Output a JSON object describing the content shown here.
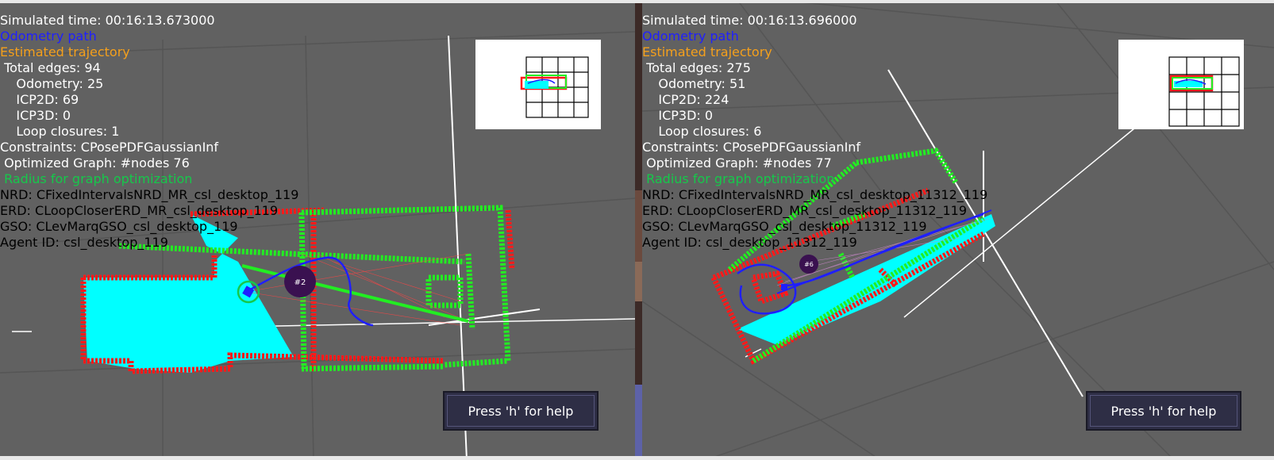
{
  "left": {
    "sim_time": "Simulated time: 00:16:13.673000",
    "odometry_path": "Odometry path",
    "estimated_trajectory": "Estimated trajectory",
    "total_edges": " Total edges: 94",
    "odometry": "    Odometry: 25",
    "icp2d": "    ICP2D: 69",
    "icp3d": "    ICP3D: 0",
    "loop_closures": "    Loop closures: 1",
    "constraints": "Constraints: CPosePDFGaussianInf",
    "optimized_graph": " Optimized Graph: #nodes 76",
    "radius": " Radius for graph optimization",
    "nrd": "NRD: CFixedIntervalsNRD_MR_csl_desktop_119",
    "erd": "ERD: CLoopCloserERD_MR_csl_desktop_119",
    "gso": "GSO: CLevMarqGSO_csl_desktop_119",
    "agent": "Agent ID: csl_desktop_119",
    "node_label": "#2",
    "help": "Press 'h' for help"
  },
  "right": {
    "sim_time": "Simulated time: 00:16:13.696000",
    "odometry_path": "Odometry path",
    "estimated_trajectory": "Estimated trajectory",
    "total_edges": " Total edges: 275",
    "odometry": "    Odometry: 51",
    "icp2d": "    ICP2D: 224",
    "icp3d": "    ICP3D: 0",
    "loop_closures": "    Loop closures: 6",
    "constraints": "Constraints: CPosePDFGaussianInf",
    "optimized_graph": " Optimized Graph: #nodes 77",
    "radius": " Radius for graph optimization",
    "nrd": "NRD: CFixedIntervalsNRD_MR_csl_desktop_11312_119",
    "erd": "ERD: CLoopCloserERD_MR_csl_desktop_11312_119",
    "gso": "GSO: CLevMarqGSO_csl_desktop_11312_119",
    "agent": "Agent ID: csl_desktop_11312_119",
    "node_label": "#6",
    "help": "Press 'h' for help"
  },
  "colors": {
    "background": "#616161",
    "odometry_path": "#1f1fff",
    "estimated_trajectory": "#f5a01c",
    "radius": "#16c84b",
    "map_red": "#ff1a1a",
    "map_green": "#22ee22",
    "free_space": "#00ffff",
    "node": "#3a1150"
  }
}
